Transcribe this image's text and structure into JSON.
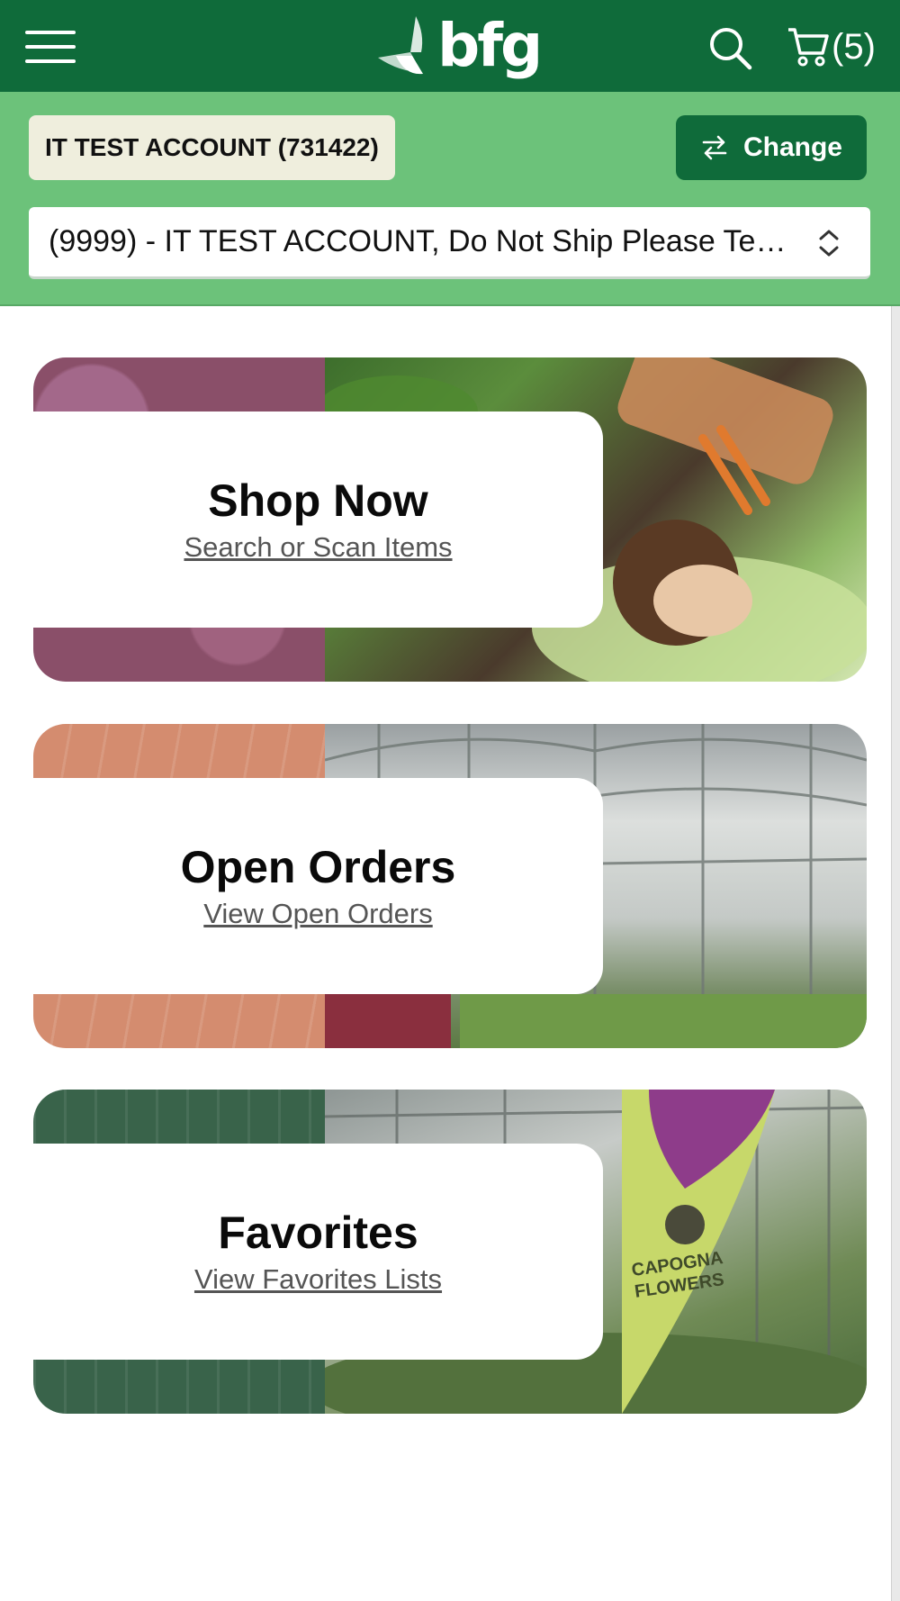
{
  "header": {
    "logo_text": "bfg",
    "cart_count": "(5)"
  },
  "account": {
    "badge": "IT TEST ACCOUNT (731422)",
    "change_label": "Change",
    "location_value": "(9999) - IT TEST ACCOUNT, Do Not Ship Please Tes..."
  },
  "cards": [
    {
      "title": "Shop Now",
      "link": "Search or Scan Items"
    },
    {
      "title": "Open Orders",
      "link": "View Open Orders"
    },
    {
      "title": "Favorites",
      "link": "View Favorites Lists"
    }
  ],
  "banner_text": "CAPOGNA FLOWERS",
  "colors": {
    "brand_dark_green": "#0f6b3a",
    "account_band_green": "#6cc27a",
    "badge_beige": "#efeedd"
  }
}
